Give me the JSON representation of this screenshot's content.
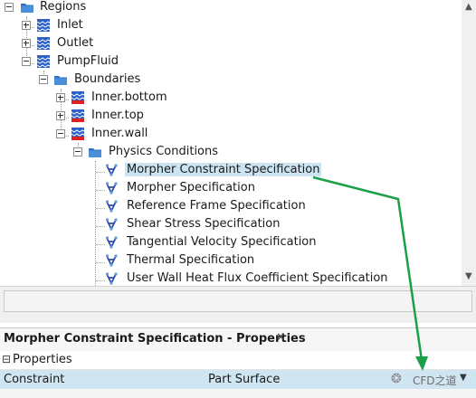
{
  "tree": {
    "items": [
      {
        "label": "Regions",
        "icon": "folder-icon"
      },
      {
        "label": "Inlet",
        "icon": "boundary-wall-icon"
      },
      {
        "label": "Outlet",
        "icon": "boundary-wall-icon"
      },
      {
        "label": "PumpFluid",
        "icon": "boundary-wall-icon"
      },
      {
        "label": "Boundaries",
        "icon": "folder-icon"
      },
      {
        "label": "Inner.bottom",
        "icon": "boundary-red-icon"
      },
      {
        "label": "Inner.top",
        "icon": "boundary-red-icon"
      },
      {
        "label": "Inner.wall",
        "icon": "boundary-red-icon"
      },
      {
        "label": "Physics Conditions",
        "icon": "folder-icon"
      },
      {
        "label": "Morpher Constraint Specification",
        "icon": "physics-condition-icon"
      },
      {
        "label": "Morpher Specification",
        "icon": "physics-condition-icon"
      },
      {
        "label": "Reference Frame Specification",
        "icon": "physics-condition-icon"
      },
      {
        "label": "Shear Stress Specification",
        "icon": "physics-condition-icon"
      },
      {
        "label": "Tangential Velocity Specification",
        "icon": "physics-condition-icon"
      },
      {
        "label": "Thermal Specification",
        "icon": "physics-condition-icon"
      },
      {
        "label": "User Wall Heat Flux Coefficient Specification",
        "icon": "physics-condition-icon"
      }
    ]
  },
  "properties_panel": {
    "title": "Morpher Constraint Specification - Properties",
    "close": "✕",
    "category": "Properties",
    "category_toggle": "⊟",
    "row": {
      "name": "Constraint",
      "value": "Part Surface"
    },
    "watermark": "CFD之道"
  },
  "colors": {
    "selection": "#cce4f1",
    "annotation": "#1aa048",
    "folder": "#2f74c4"
  }
}
